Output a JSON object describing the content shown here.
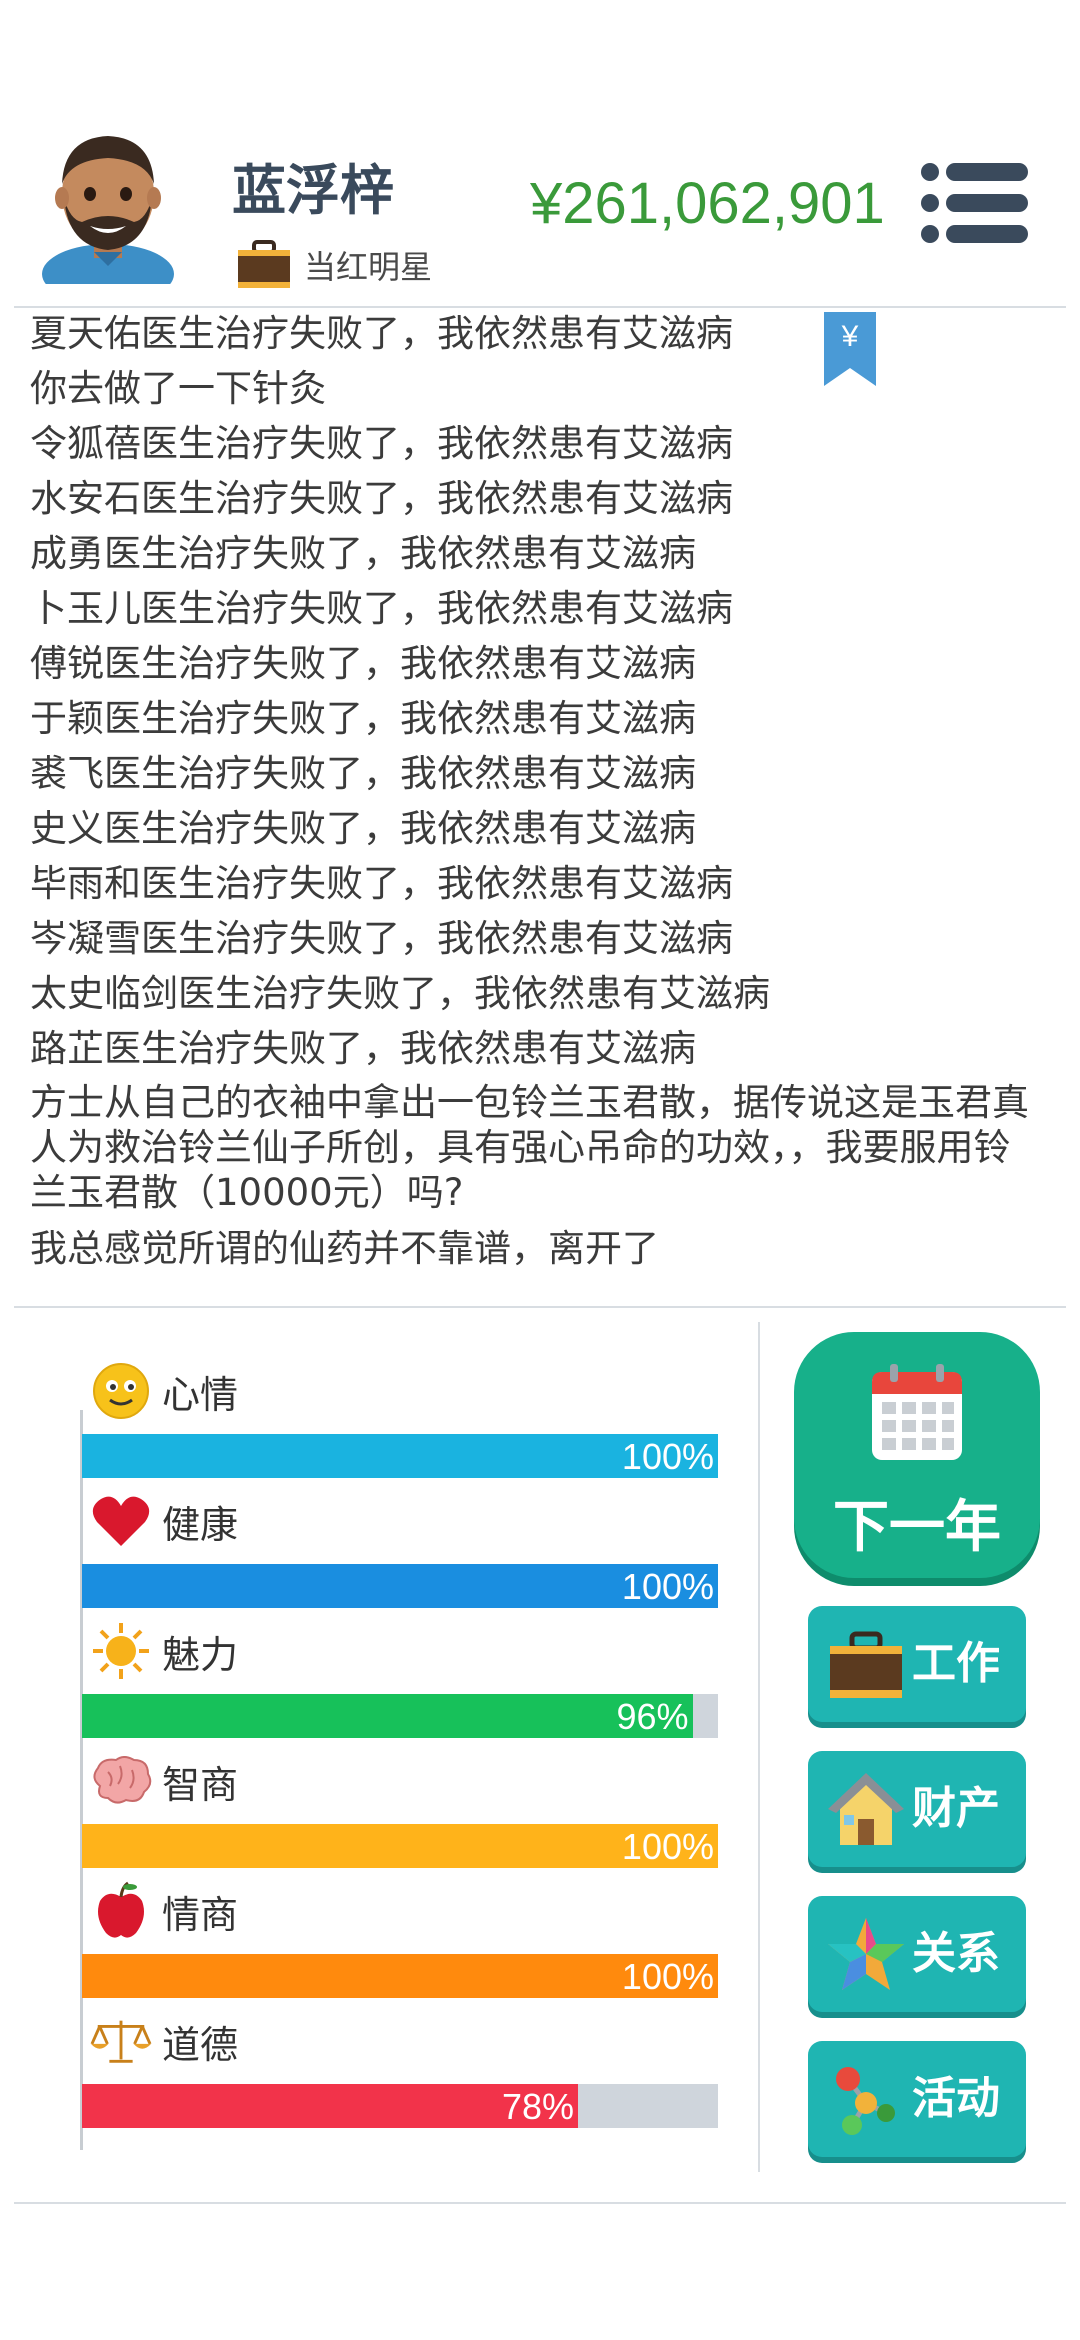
{
  "player": {
    "name": "蓝浮梓",
    "job_title": "当红明星",
    "money": "¥261,062,901"
  },
  "log": {
    "lines": [
      "夏天佑医生治疗失败了，我依然患有艾滋病",
      "你去做了一下针灸",
      "令狐蓓医生治疗失败了，我依然患有艾滋病",
      "水安石医生治疗失败了，我依然患有艾滋病",
      "成勇医生治疗失败了，我依然患有艾滋病",
      "卜玉儿医生治疗失败了，我依然患有艾滋病",
      "傅锐医生治疗失败了，我依然患有艾滋病",
      "于颖医生治疗失败了，我依然患有艾滋病",
      "裘飞医生治疗失败了，我依然患有艾滋病",
      "史义医生治疗失败了，我依然患有艾滋病",
      "毕雨和医生治疗失败了，我依然患有艾滋病",
      "岑凝雪医生治疗失败了，我依然患有艾滋病",
      "太史临剑医生治疗失败了，我依然患有艾滋病",
      "路芷医生治疗失败了，我依然患有艾滋病",
      "方士从自己的衣袖中拿出一包铃兰玉君散，据传说这是玉君真人为救治铃兰仙子所创，具有强心吊命的功效，，我要服用铃兰玉君散（10000元）吗?",
      "我总感觉所谓的仙药并不靠谱，离开了"
    ],
    "bookmark_symbol": "¥"
  },
  "stats": [
    {
      "label": "心情",
      "percent_text": "100%",
      "value": 100,
      "color": "#1ab3e0",
      "icon": "smiley-face-icon"
    },
    {
      "label": "健康",
      "percent_text": "100%",
      "value": 100,
      "color": "#1a8ee0",
      "icon": "heart-icon"
    },
    {
      "label": "魅力",
      "percent_text": "96%",
      "value": 96,
      "color": "#17c15a",
      "icon": "sun-icon"
    },
    {
      "label": "智商",
      "percent_text": "100%",
      "value": 100,
      "color": "#ffb31a",
      "icon": "brain-icon"
    },
    {
      "label": "情商",
      "percent_text": "100%",
      "value": 100,
      "color": "#ff8a0d",
      "icon": "apple-icon"
    },
    {
      "label": "道德",
      "percent_text": "78%",
      "value": 78,
      "color": "#f2334a",
      "icon": "scales-icon"
    }
  ],
  "actions": {
    "next_year": "下一年",
    "work": "工作",
    "property": "财产",
    "relations": "关系",
    "activities": "活动"
  }
}
